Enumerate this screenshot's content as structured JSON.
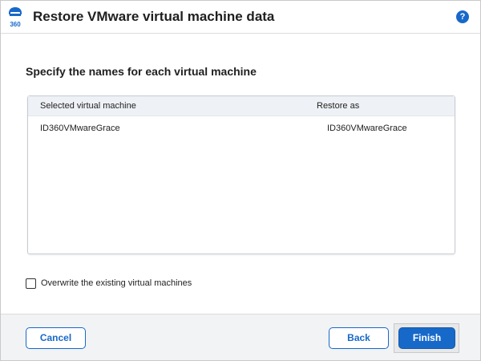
{
  "window": {
    "title": "Restore VMware virtual machine data",
    "logo_text": "360",
    "help_label": "?"
  },
  "main": {
    "heading": "Specify the names for each virtual machine",
    "table": {
      "columns": [
        "Selected virtual machine",
        "Restore as"
      ],
      "rows": [
        [
          "ID360VMwareGrace",
          "ID360VMwareGrace"
        ]
      ]
    },
    "overwrite_label": "Overwrite the existing virtual machines",
    "overwrite_checked": false
  },
  "footer": {
    "cancel_label": "Cancel",
    "back_label": "Back",
    "finish_label": "Finish"
  },
  "colors": {
    "accent": "#1769c9",
    "table_header_bg": "#eef1f5",
    "footer_bg": "#f2f3f5"
  }
}
